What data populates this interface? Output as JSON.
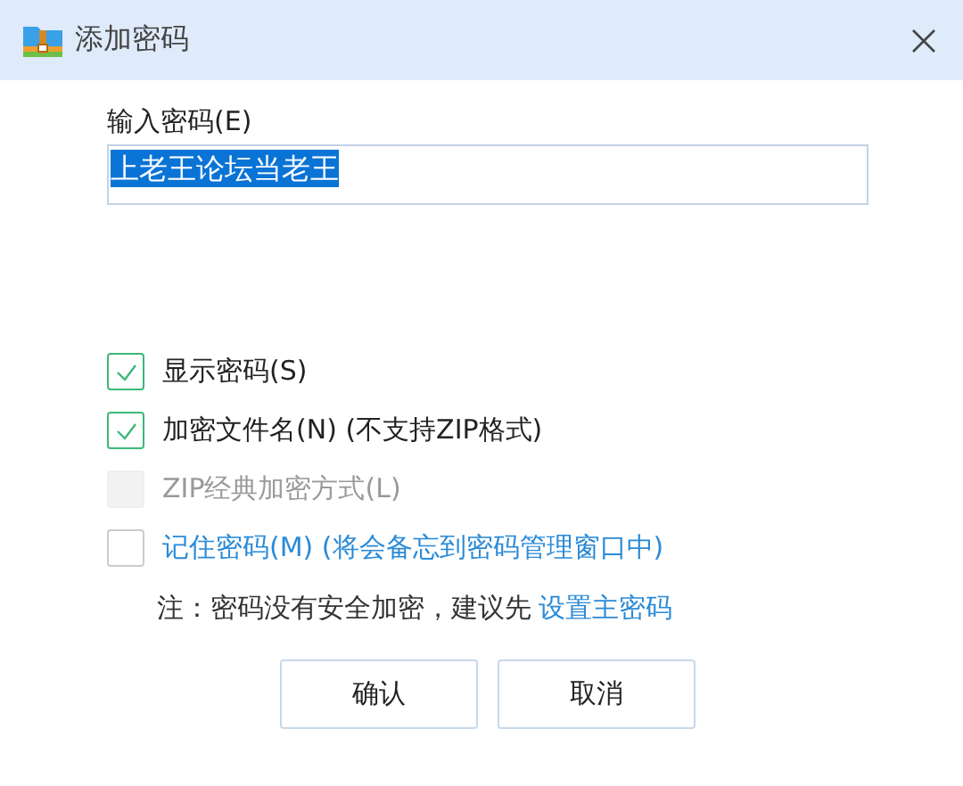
{
  "window": {
    "title": "添加密码"
  },
  "password": {
    "label": "输入密码(E)",
    "value": "上老王论坛当老王",
    "value_selected": true
  },
  "options": [
    {
      "label": "显示密码(S)",
      "checked": true,
      "disabled": false,
      "kind": "plain"
    },
    {
      "label": "加密文件名(N) (不支持ZIP格式)",
      "checked": true,
      "disabled": false,
      "kind": "plain"
    },
    {
      "label": "ZIP经典加密方式(L)",
      "checked": false,
      "disabled": true,
      "kind": "plain"
    },
    {
      "label": "记住密码(M) (将会备忘到密码管理窗口中)",
      "checked": false,
      "disabled": false,
      "kind": "link"
    }
  ],
  "note": {
    "text": "注：密码没有安全加密，建议先",
    "link": "设置主密码"
  },
  "buttons": [
    "确认",
    "取消"
  ]
}
